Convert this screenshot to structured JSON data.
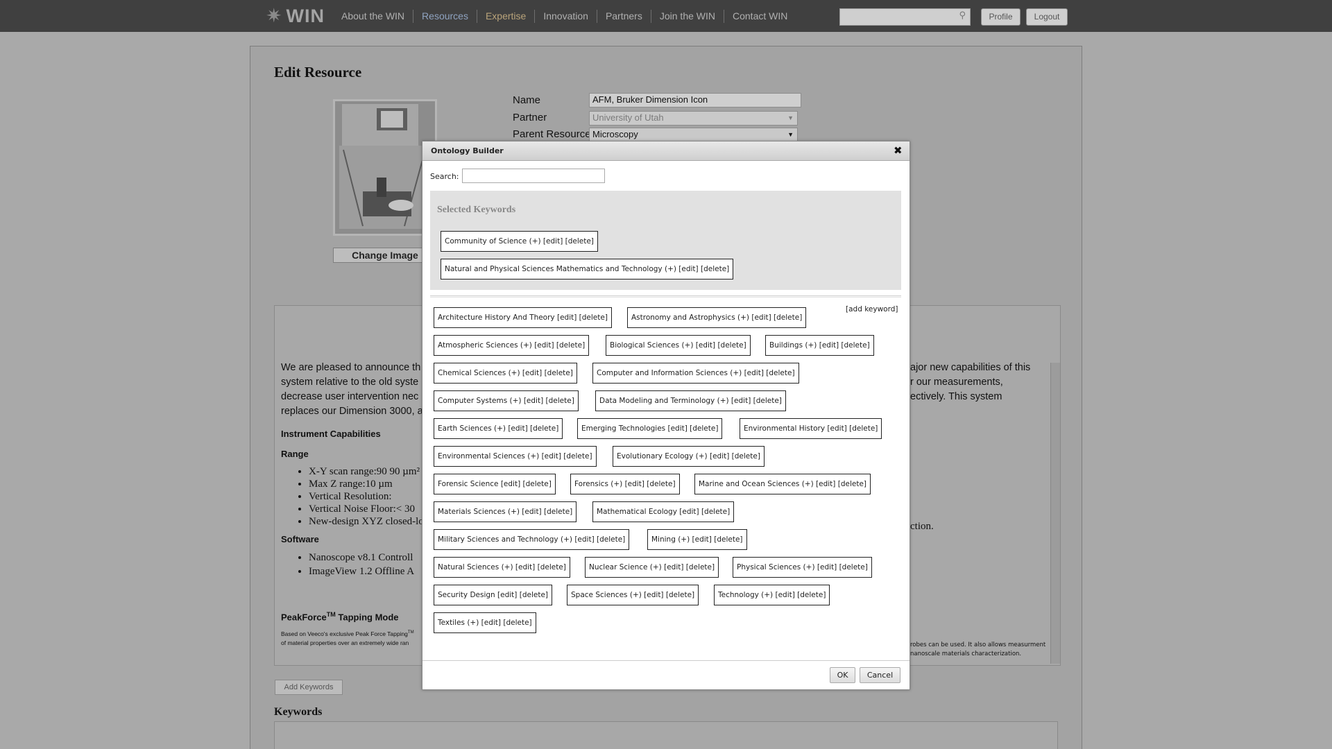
{
  "nav": {
    "logo_text": "WIN",
    "links": [
      "About the WIN",
      "Resources",
      "Expertise",
      "Innovation",
      "Partners",
      "Join the WIN",
      "Contact WIN"
    ],
    "search_placeholder": "",
    "profile_label": "Profile",
    "logout_label": "Logout"
  },
  "page": {
    "title": "Edit Resource",
    "change_image_label": "Change Image",
    "fields": {
      "name_label": "Name",
      "name_value": "AFM, Bruker Dimension Icon",
      "partner_label": "Partner",
      "partner_value": "University of Utah",
      "parent_label": "Parent Resource",
      "parent_value": "Microscopy"
    },
    "description": {
      "intro_lines": [
        "We are pleased to announce th",
        "system relative to the old syste",
        "decrease user intervention nec",
        "replaces our Dimension 3000, a"
      ],
      "intro_right_lines": [
        "ajor new capabilities of this",
        "r our measurements,",
        "ectively.  This system"
      ],
      "capabilities_heading": "Instrument Capabilities",
      "range_heading": "Range",
      "range_items": [
        "X-Y scan range:90 90 µm²",
        "Max Z range:10 µm",
        "Vertical Resolution:",
        "Vertical Noise Floor:< 30",
        "New-design XYZ closed-lo"
      ],
      "range_right_text": "ction.",
      "software_heading": "Software",
      "software_items": [
        "Nanoscope v8.1 Controll",
        "ImageView 1.2 Offline A"
      ],
      "peakforce_heading": "PeakForce",
      "peakforce_tm": "TM",
      "peakforce_rest": " Tapping Mode",
      "small_left_1": "Based on Veeco's exclusive Peak Force Tapping",
      "small_tm": "TM",
      "small_left_2": "of material properties over an extremely wide ran",
      "small_right_1": "robes can be used. It also allows measurment",
      "small_right_2": "nanoscale materials characterization."
    },
    "add_keywords_label": "Add Keywords",
    "keywords_heading": "Keywords"
  },
  "modal": {
    "title": "Ontology Builder",
    "close_glyph": "✖",
    "search_label": "Search:",
    "search_value": "",
    "selected_heading": "Selected Keywords",
    "selected_keywords": [
      "Community of Science (+) [edit] [delete]",
      "Natural and Physical Sciences Mathematics and Technology (+) [edit] [delete]"
    ],
    "add_keyword_label": "[add keyword]",
    "keyword_rows": [
      [
        "Architecture History And Theory [edit] [delete]",
        "Astronomy and Astrophysics (+) [edit] [delete]"
      ],
      [
        "Atmospheric Sciences (+) [edit] [delete]",
        "Biological Sciences (+) [edit] [delete]",
        "Buildings (+) [edit] [delete]"
      ],
      [
        "Chemical Sciences (+) [edit] [delete]",
        "Computer and Information Sciences (+) [edit] [delete]"
      ],
      [
        "Computer Systems (+) [edit] [delete]",
        "Data Modeling and Terminology (+) [edit] [delete]"
      ],
      [
        "Earth Sciences (+) [edit] [delete]",
        "Emerging Technologies [edit] [delete]",
        "Environmental History [edit] [delete]"
      ],
      [
        "Environmental Sciences (+) [edit] [delete]",
        "Evolutionary Ecology (+) [edit] [delete]"
      ],
      [
        "Forensic Science [edit] [delete]",
        "Forensics (+) [edit] [delete]",
        "Marine and Ocean Sciences (+) [edit] [delete]"
      ],
      [
        "Materials Sciences (+) [edit] [delete]",
        "Mathematical Ecology [edit] [delete]"
      ],
      [
        "Military Sciences and Technology (+) [edit] [delete]",
        "Mining (+) [edit] [delete]"
      ],
      [
        "Natural Sciences (+) [edit] [delete]",
        "Nuclear Science (+) [edit] [delete]",
        "Physical Sciences (+) [edit] [delete]"
      ],
      [
        "Security Design [edit] [delete]",
        "Space Sciences (+) [edit] [delete]",
        "Technology (+) [edit] [delete]"
      ],
      [
        "Textiles (+) [edit] [delete]"
      ]
    ],
    "ok_label": "OK",
    "cancel_label": "Cancel"
  }
}
